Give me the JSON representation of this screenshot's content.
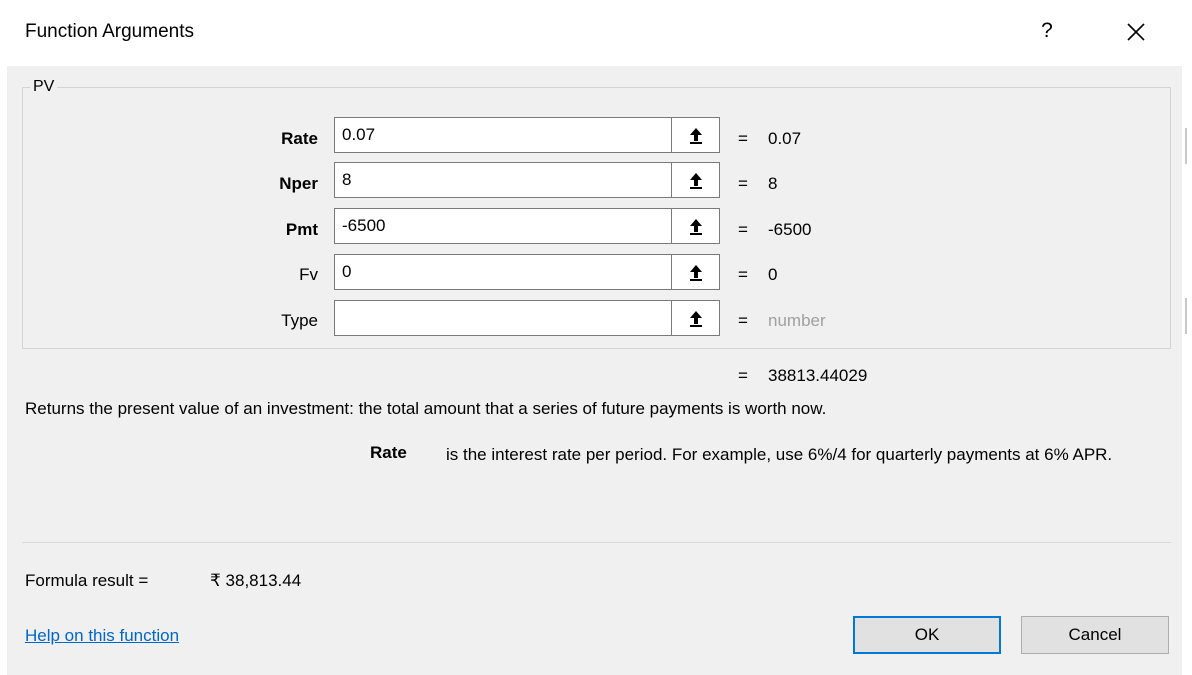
{
  "dialog": {
    "title": "Function Arguments",
    "help_glyph": "?",
    "close_glyph": "×"
  },
  "function": {
    "name": "PV",
    "arguments": [
      {
        "label": "Rate",
        "bold": true,
        "input_value": "0.07",
        "evaluated": "0.07",
        "placeholder_value": false
      },
      {
        "label": "Nper",
        "bold": true,
        "input_value": "8",
        "evaluated": "8",
        "placeholder_value": false
      },
      {
        "label": "Pmt",
        "bold": true,
        "input_value": "-6500",
        "evaluated": "-6500",
        "placeholder_value": false
      },
      {
        "label": "Fv",
        "bold": false,
        "input_value": "0",
        "evaluated": "0",
        "placeholder_value": false
      },
      {
        "label": "Type",
        "bold": false,
        "input_value": "",
        "evaluated": "number",
        "placeholder_value": true
      }
    ],
    "equals_sign": "=",
    "result": "38813.44029",
    "description": "Returns the present value of an investment: the total amount that a series of future payments is worth now.",
    "arg_help": {
      "name": "Rate",
      "text": "is the interest rate per period. For example, use 6%/4 for quarterly payments at 6% APR."
    }
  },
  "footer": {
    "formula_result_label": "Formula result =",
    "formula_result_value": "₹ 38,813.44",
    "help_link": "Help on this function",
    "ok_label": "OK",
    "cancel_label": "Cancel"
  },
  "colors": {
    "dialog_bg": "#f0f0f0",
    "link": "#0066cc",
    "ok_border": "#0078d7",
    "placeholder_text": "#a0a0a0"
  }
}
